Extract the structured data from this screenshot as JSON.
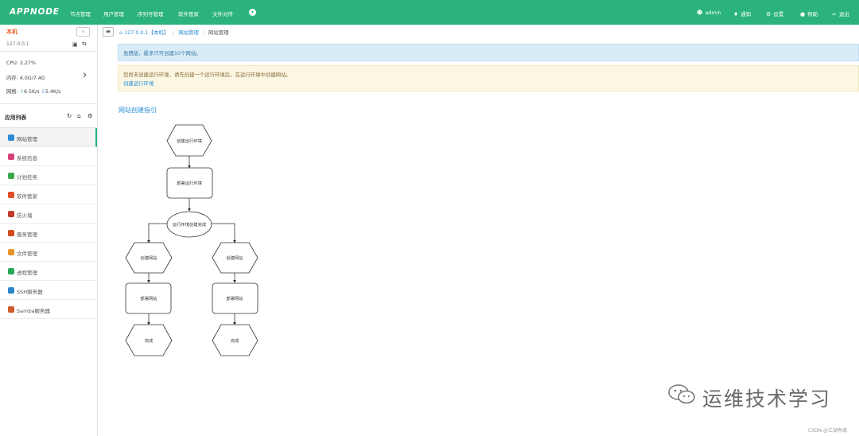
{
  "topbar": {
    "logo": "APPNODE",
    "nav": [
      "节点管理",
      "用户管理",
      "序列号管理",
      "软件管家",
      "文件对传"
    ],
    "chevron": "▾",
    "user_label": "admin",
    "notify_label": "通知",
    "settings_label": "设置",
    "help_label": "帮助",
    "logout_label": "退出",
    "user_icon": "user-icon",
    "notify_icon": "bell-icon",
    "settings_icon": "gear-icon",
    "help_icon": "lightbulb-icon",
    "logout_icon": "logout-icon"
  },
  "host": {
    "name": "本机",
    "ip": "127.0.0.1",
    "collapse": "‹",
    "terminal_icon": "terminal-icon",
    "switch_icon": "switch-icon"
  },
  "stats": {
    "cpu_label": "CPU:",
    "cpu_value": "2.27%",
    "mem_label": "内存:",
    "mem_value": "4.0G/7.4G",
    "net_label": "网络:",
    "net_up": "6.5K/s",
    "net_down": "5.4K/s",
    "expand": "›"
  },
  "apps": {
    "title": "应用列表",
    "refresh_icon": "refresh-icon",
    "home_icon": "home-icon",
    "settings_icon": "gear-icon",
    "items": [
      {
        "label": "网站管理",
        "color": "#2b8ad6"
      },
      {
        "label": "系统信息",
        "color": "#d6407a"
      },
      {
        "label": "计划任务",
        "color": "#3aa848"
      },
      {
        "label": "软件管家",
        "color": "#e04f2b"
      },
      {
        "label": "防火墙",
        "color": "#c0392b"
      },
      {
        "label": "服务管理",
        "color": "#d04a1e"
      },
      {
        "label": "文件管理",
        "color": "#e8962b"
      },
      {
        "label": "进程管理",
        "color": "#27a65a"
      },
      {
        "label": "SSH服务器",
        "color": "#2a86c8"
      },
      {
        "label": "Samba服务器",
        "color": "#d05a2a"
      }
    ]
  },
  "breadcrumb": {
    "menu": "≡",
    "home": "127.0.0.1【本机】",
    "sep": "/",
    "level2": "网站管理",
    "current": "网站管理"
  },
  "alerts": {
    "info": "免费版，最多只可创建10个网站。",
    "warning": "您尚未创建运行环境，请先创建一个运行环境后，在运行环境中创建网站。",
    "warning_link": "创建运行环境"
  },
  "guide": {
    "title": "网站创建指引",
    "nodes": {
      "create_env": "创建运行环境",
      "deploy_env": "部署运行环境",
      "env_done": "运行环境创建完成",
      "create_site_left": "创建网站",
      "create_site_right": "创建网站",
      "deploy_site_left": "部署网站",
      "deploy_site_right": "部署网站",
      "done_left": "完成",
      "done_right": "完成"
    }
  },
  "watermark": {
    "text": "运维技术学习",
    "csdn": "CSDN @江湖有缘"
  }
}
